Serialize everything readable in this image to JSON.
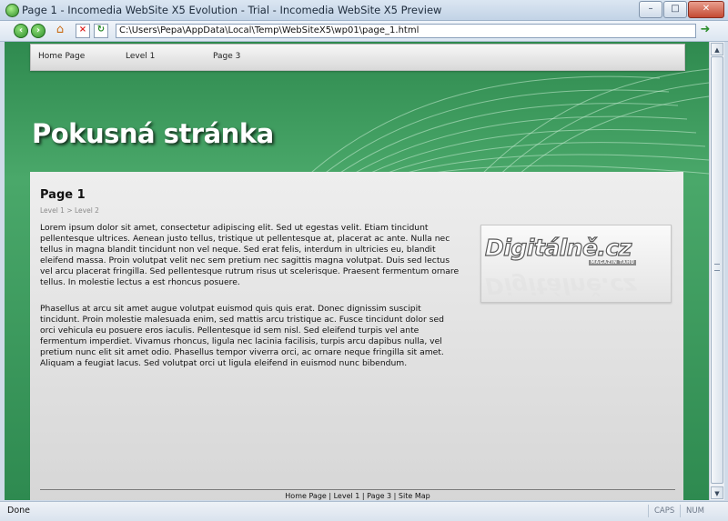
{
  "window": {
    "title": "Page 1 - Incomedia WebSite X5 Evolution - Trial - Incomedia WebSite X5 Preview",
    "minimize": "–",
    "maximize": "□",
    "close": "✕"
  },
  "toolbar": {
    "back_icon": "‹",
    "forward_icon": "›",
    "home_icon": "⌂",
    "stop_icon": "×",
    "refresh_icon": "↻",
    "address": "C:\\Users\\Pepa\\AppData\\Local\\Temp\\WebSiteX5\\wp01\\page_1.html",
    "go_icon": "➜"
  },
  "site": {
    "nav": [
      "Home Page",
      "Level 1",
      "Page 3"
    ],
    "title": "Pokusná stránka",
    "page_heading": "Page 1",
    "breadcrumb": "Level 1 > Level 2",
    "paragraph1": "Lorem ipsum dolor sit amet, consectetur adipiscing elit. Sed ut egestas velit. Etiam tincidunt pellentesque ultrices. Aenean justo tellus, tristique ut pellentesque at, placerat ac ante. Nulla nec tellus in magna blandit tincidunt non vel neque. Sed erat felis, interdum in ultricies eu, blandit eleifend massa. Proin volutpat velit nec sem pretium nec sagittis magna volutpat. Duis sed lectus vel arcu placerat fringilla. Sed pellentesque rutrum risus ut scelerisque. Praesent fermentum ornare tellus. In molestie lectus a est rhoncus posuere.",
    "paragraph2": "Phasellus at arcu sit amet augue volutpat euismod quis quis erat. Donec dignissim suscipit tincidunt. Proin molestie malesuada enim, sed mattis arcu tristique ac. Fusce tincidunt dolor sed orci vehicula eu posuere eros iaculis. Pellentesque id sem nisl. Sed eleifend turpis vel ante fermentum imperdiet. Vivamus rhoncus, ligula nec lacinia facilisis, turpis arcu dapibus nulla, vel pretium nunc elit sit amet odio. Phasellus tempor viverra orci, ac ornare neque fringilla sit amet. Aliquam a feugiat lacus. Sed volutpat orci ut ligula eleifend in euismod nunc bibendum.",
    "logo_text": "Digitálně.cz",
    "logo_tagline": "MAGAZÍN TAHŮ",
    "footer": "Home Page | Level 1 | Page 3 | Site Map"
  },
  "statusbar": {
    "text": "Done",
    "caps": "CAPS",
    "num": "NUM"
  },
  "colors": {
    "page_green": "#3b9a5c",
    "titlebar": "#c2d3e6"
  }
}
